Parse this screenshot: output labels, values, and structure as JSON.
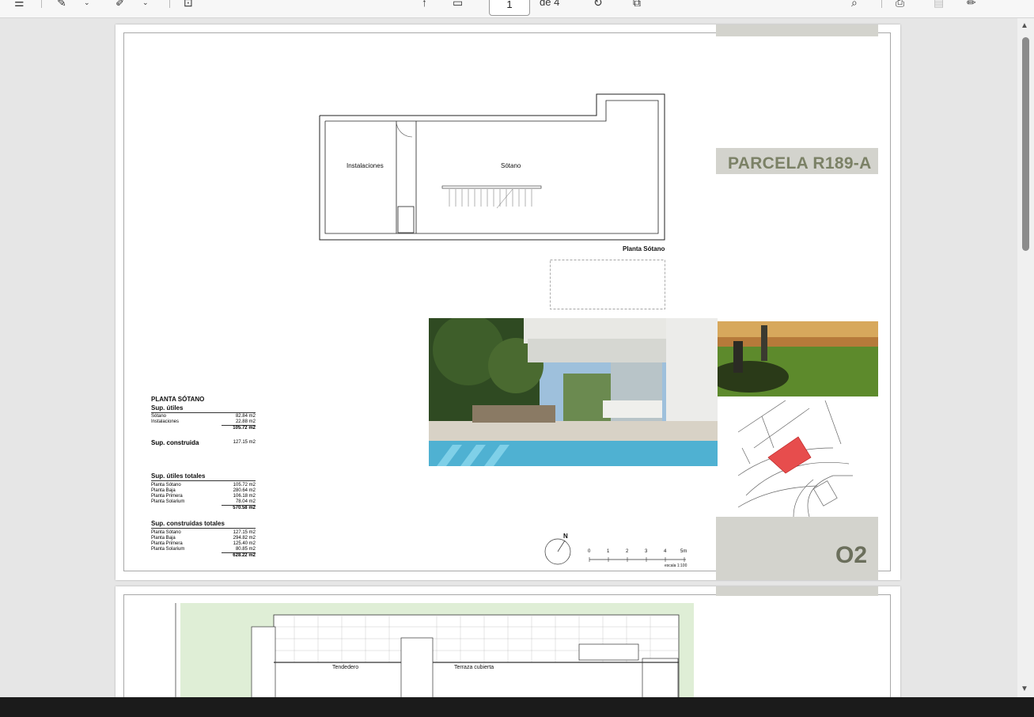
{
  "toolbar": {
    "current_page": "1",
    "page_of": "de 4"
  },
  "page1": {
    "title": "PARCELA R189-A",
    "sheet_number": "O2",
    "rooms": {
      "installations": "Instalaciones",
      "basement": "Sótano"
    },
    "plan_caption": "Planta Sótano",
    "scale_label": "escala 1:100",
    "north_label": "N",
    "scale_ticks": [
      "0",
      "1",
      "2",
      "3",
      "4",
      "5m"
    ],
    "table": {
      "heading": "PLANTA SÓTANO",
      "useful_title": "Sup. útiles",
      "useful_rows": [
        {
          "label": "Sótano",
          "value": "82.84 m2"
        },
        {
          "label": "Instalaciones",
          "value": "22.88 m2"
        }
      ],
      "useful_total": "105.72 m2",
      "built_label": "Sup. construida",
      "built_value": "127.15 m2",
      "useful_totals_title": "Sup. útiles totales",
      "useful_totals_rows": [
        {
          "label": "Planta Sótano",
          "value": "105.72 m2"
        },
        {
          "label": "Planta Baja",
          "value": "280.64 m2"
        },
        {
          "label": "Planta Primera",
          "value": "106.18 m2"
        },
        {
          "label": "Planta Solarium",
          "value": "78.04 m2"
        }
      ],
      "useful_totals_sum": "570.58 m2",
      "built_totals_title": "Sup. construidas totales",
      "built_totals_rows": [
        {
          "label": "Planta Sótano",
          "value": "127.15 m2"
        },
        {
          "label": "Planta Baja",
          "value": "294.82 m2"
        },
        {
          "label": "Planta Primera",
          "value": "125.40 m2"
        },
        {
          "label": "Planta Solarium",
          "value": "80.85 m2"
        }
      ],
      "built_totals_sum": "628.22 m2"
    }
  },
  "page2": {
    "labels": {
      "laundry": "Tendedero",
      "covered_terrace": "Terraza cubierta"
    }
  },
  "icons": [
    "menu-icon",
    "draw-icon",
    "highlight-icon",
    "text-box-icon",
    "fit-page-icon",
    "rotate-icon",
    "two-page-icon",
    "search-icon",
    "print-icon",
    "save-icon",
    "edit-icon"
  ]
}
